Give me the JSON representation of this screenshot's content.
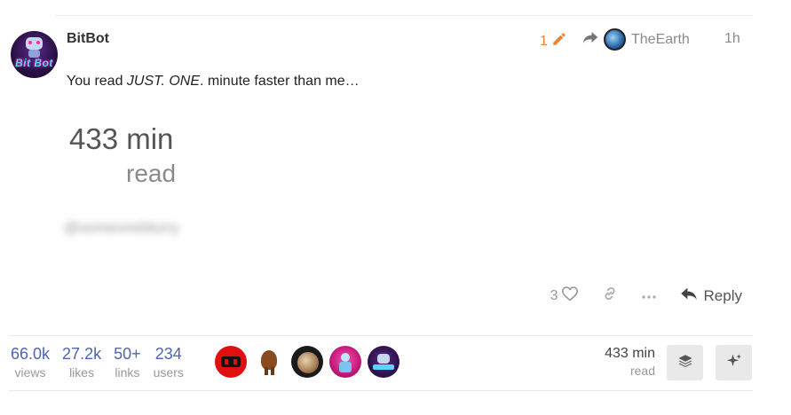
{
  "post": {
    "username": "BitBot",
    "avatar_text": "Bit Bot",
    "edit_count": "1",
    "reply_to_user": "TheEarth",
    "timestamp": "1h",
    "text_before": "You read ",
    "text_emphasis": "JUST. ONE",
    "text_after": ". minute faster than me…",
    "big_minutes": "433 min",
    "big_read": "read",
    "blurred_text": "@someoneblurry"
  },
  "actions": {
    "like_count": "3",
    "reply_label": "Reply"
  },
  "topic_map": {
    "stats": [
      {
        "num": "66.0k",
        "label": "views"
      },
      {
        "num": "27.2k",
        "label": "likes"
      },
      {
        "num": "50+",
        "label": "links"
      },
      {
        "num": "234",
        "label": "users"
      }
    ],
    "read_time": "433 min",
    "read_label": "read"
  },
  "colors": {
    "accent_blue": "#4f65b4",
    "edit_orange": "#e8833a"
  },
  "icons": [
    "pencil-icon",
    "share-arrow-icon",
    "heart-icon",
    "link-icon",
    "ellipsis-icon",
    "reply-icon",
    "layers-icon",
    "sparkle-icon"
  ]
}
